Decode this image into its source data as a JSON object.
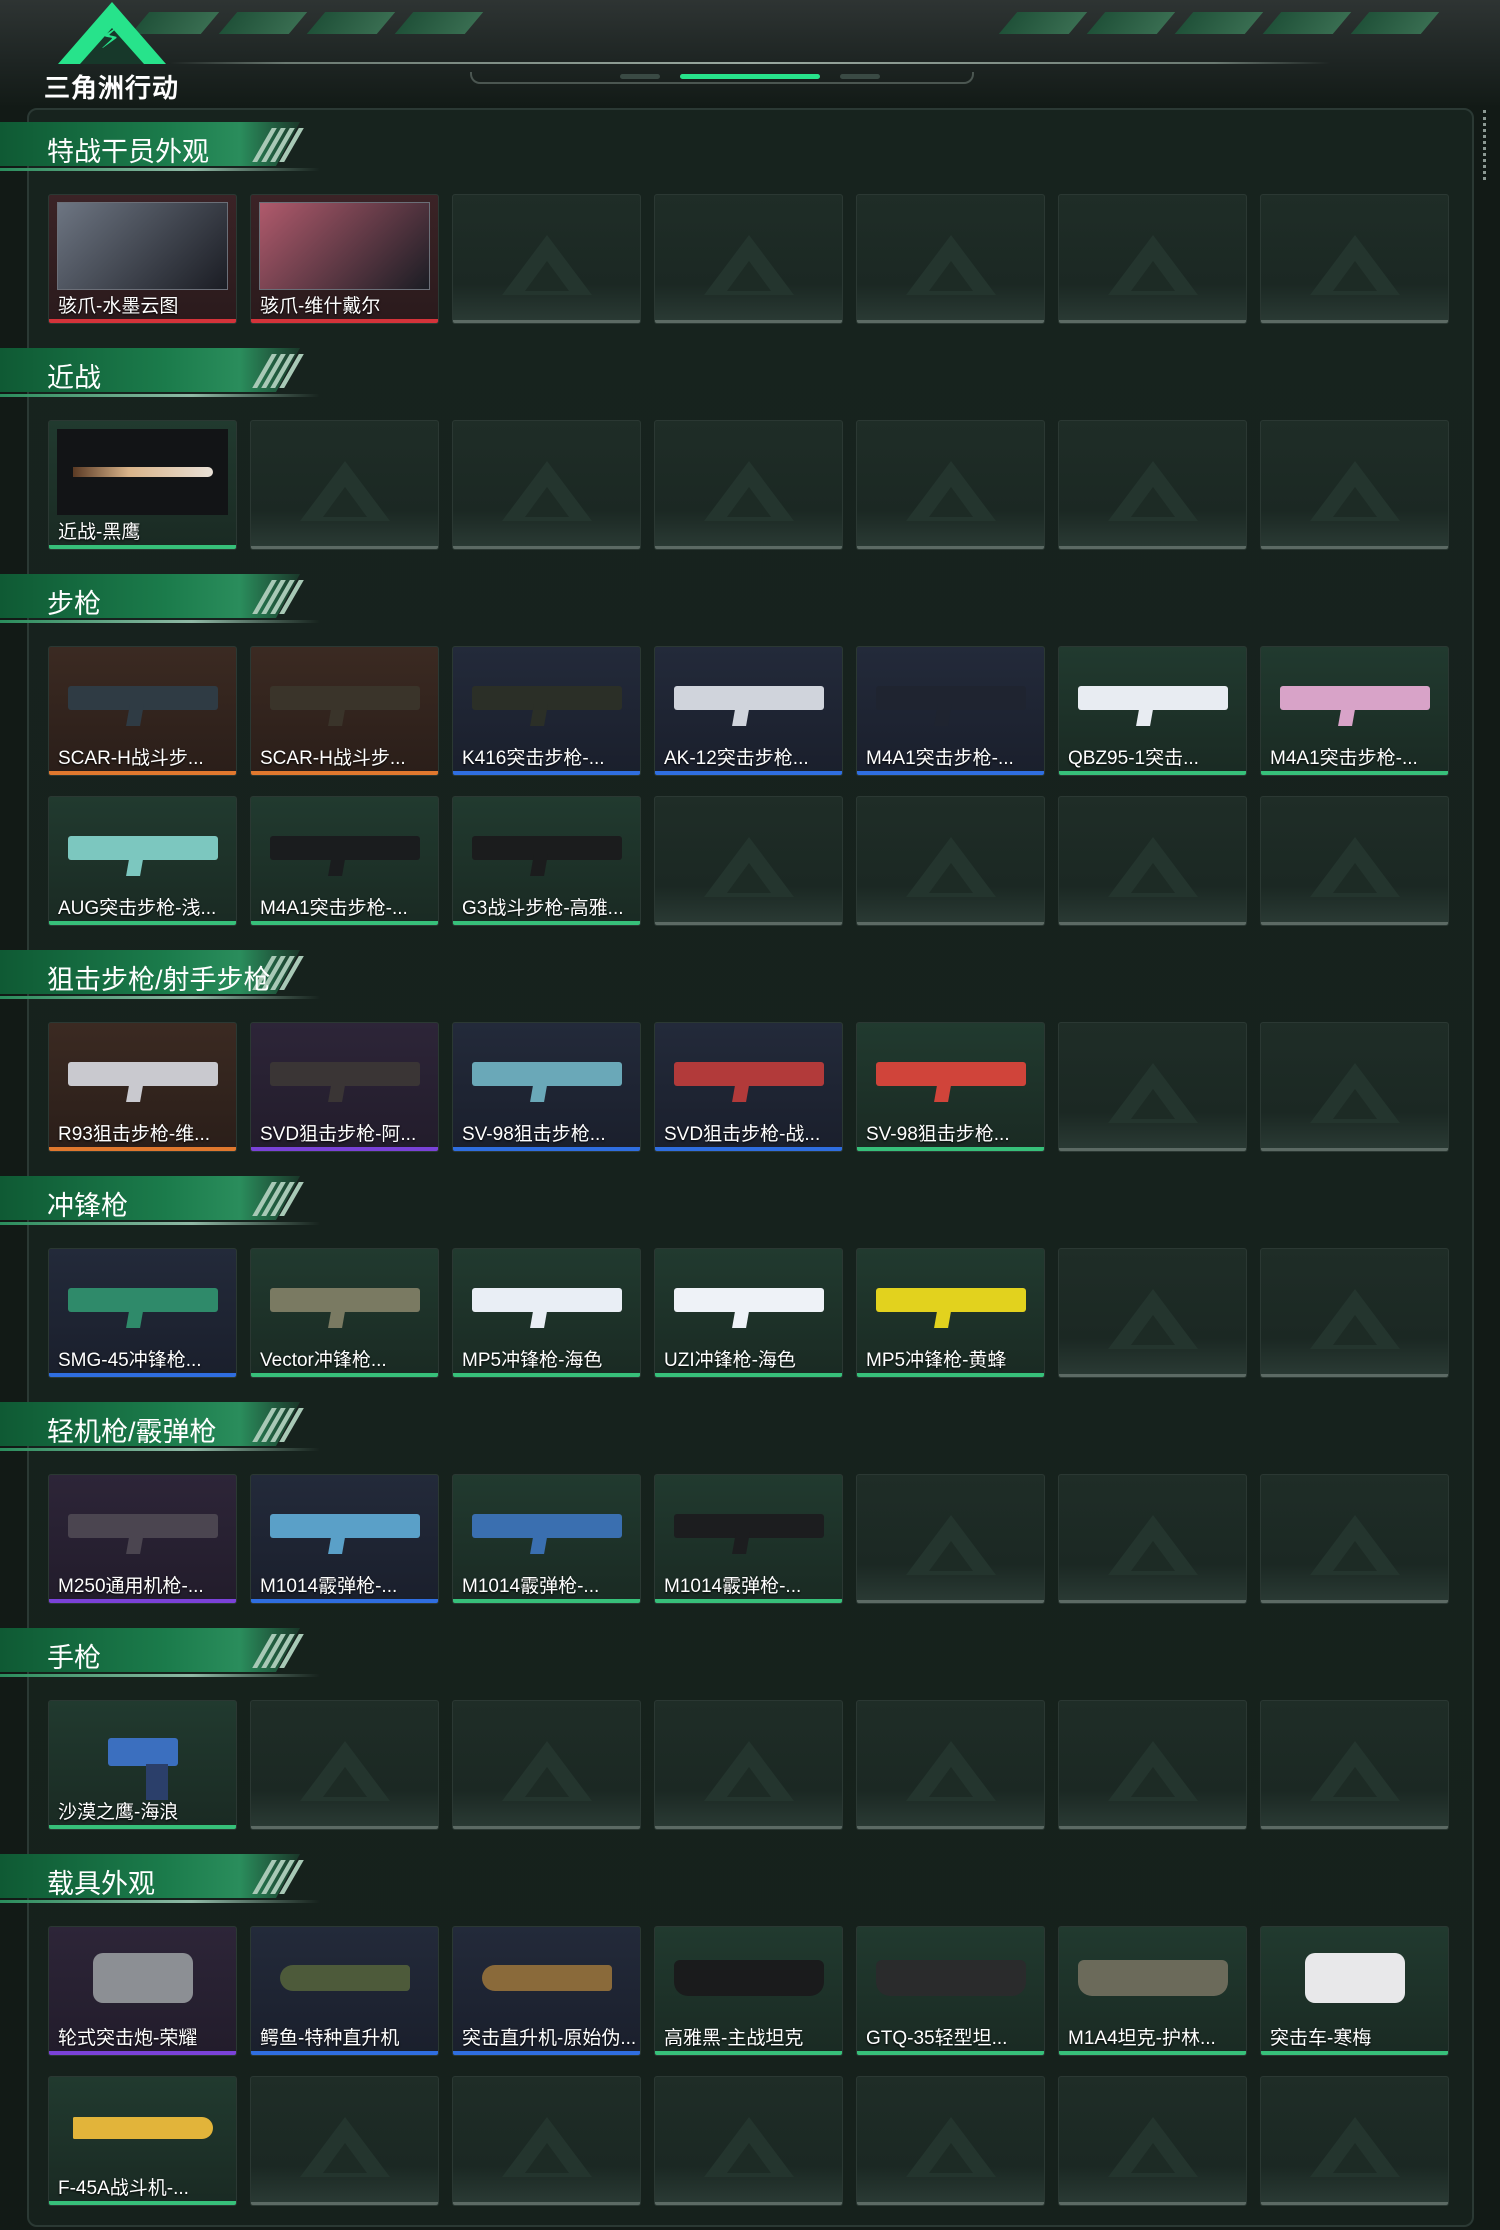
{
  "header": {
    "logo_text": "三角洲行动"
  },
  "sections": [
    {
      "title": "特战干员外观",
      "items": [
        {
          "name": "骇爪-水墨云图",
          "rarity": "red",
          "art": "portrait",
          "color": "#6d7582",
          "label": "水墨云图"
        },
        {
          "name": "骇爪-维什戴尔",
          "rarity": "red",
          "art": "portrait",
          "color": "#b05a6c",
          "label": "维什戴尔"
        }
      ]
    },
    {
      "title": "近战",
      "items": [
        {
          "name": "近战-黑鹰",
          "rarity": "green",
          "art": "knife",
          "color": "#d9b48a"
        }
      ]
    },
    {
      "title": "步枪",
      "items": [
        {
          "name": "SCAR-H战斗步...",
          "rarity": "orange",
          "art": "gun",
          "color": "#2f3b44"
        },
        {
          "name": "SCAR-H战斗步...",
          "rarity": "orange",
          "art": "gun",
          "color": "#3a342a"
        },
        {
          "name": "K416突击步枪-...",
          "rarity": "blue",
          "art": "gun",
          "color": "#2b2f27"
        },
        {
          "name": "AK-12突击步枪...",
          "rarity": "blue",
          "art": "gun",
          "color": "#d0d4dc"
        },
        {
          "name": "M4A1突击步枪-...",
          "rarity": "blue",
          "art": "gun",
          "color": "#1f2430"
        },
        {
          "name": "QBZ95-1突击...",
          "rarity": "green",
          "art": "gun",
          "color": "#e8ecf2"
        },
        {
          "name": "M4A1突击步枪-...",
          "rarity": "green",
          "art": "gun",
          "color": "#d8a3c8"
        },
        {
          "name": "AUG突击步枪-浅...",
          "rarity": "green",
          "art": "gun",
          "color": "#7cc7bf"
        },
        {
          "name": "M4A1突击步枪-...",
          "rarity": "green",
          "art": "gun",
          "color": "#1a1c1e"
        },
        {
          "name": "G3战斗步枪-高雅...",
          "rarity": "green",
          "art": "gun",
          "color": "#1b1c1d"
        }
      ]
    },
    {
      "title": "狙击步枪/射手步枪",
      "items": [
        {
          "name": "R93狙击步枪-维...",
          "rarity": "orange",
          "art": "gun",
          "color": "#c9c9cf"
        },
        {
          "name": "SVD狙击步枪-阿...",
          "rarity": "purple",
          "art": "gun",
          "color": "#3a3535"
        },
        {
          "name": "SV-98狙击步枪...",
          "rarity": "blue",
          "art": "gun",
          "color": "#6aa8b8"
        },
        {
          "name": "SVD狙击步枪-战...",
          "rarity": "blue",
          "art": "gun",
          "color": "#b23a3a"
        },
        {
          "name": "SV-98狙击步枪...",
          "rarity": "green",
          "art": "gun",
          "color": "#d0443a"
        }
      ]
    },
    {
      "title": "冲锋枪",
      "items": [
        {
          "name": "SMG-45冲锋枪...",
          "rarity": "blue",
          "art": "gun",
          "color": "#2f8a6a"
        },
        {
          "name": "Vector冲锋枪...",
          "rarity": "green",
          "art": "gun",
          "color": "#7a7a62"
        },
        {
          "name": "MP5冲锋枪-海色",
          "rarity": "green",
          "art": "gun",
          "color": "#e9eef5"
        },
        {
          "name": "UZI冲锋枪-海色",
          "rarity": "green",
          "art": "gun",
          "color": "#eef2f7"
        },
        {
          "name": "MP5冲锋枪-黄蜂",
          "rarity": "green",
          "art": "gun",
          "color": "#e2d21e"
        }
      ]
    },
    {
      "title": "轻机枪/霰弹枪",
      "items": [
        {
          "name": "M250通用机枪-...",
          "rarity": "purple",
          "art": "gun",
          "color": "#4b4550"
        },
        {
          "name": "M1014霰弹枪-...",
          "rarity": "blue",
          "art": "gun",
          "color": "#5aa0c8"
        },
        {
          "name": "M1014霰弹枪-...",
          "rarity": "green",
          "art": "gun",
          "color": "#3a6fb0"
        },
        {
          "name": "M1014霰弹枪-...",
          "rarity": "green",
          "art": "gun",
          "color": "#1c1d1f"
        }
      ]
    },
    {
      "title": "手枪",
      "items": [
        {
          "name": "沙漠之鹰-海浪",
          "rarity": "green",
          "art": "pistol",
          "color": "#3b6fbf"
        }
      ]
    },
    {
      "title": "载具外观",
      "items": [
        {
          "name": "轮式突击炮-荣耀",
          "rarity": "purple",
          "art": "vehicle",
          "color": "#8c8f94"
        },
        {
          "name": "鳄鱼-特种直升机",
          "rarity": "blue",
          "art": "heli",
          "color": "#4d5a3a"
        },
        {
          "name": "突击直升机-原始伪...",
          "rarity": "blue",
          "art": "heli",
          "color": "#8a6a3a"
        },
        {
          "name": "高雅黑-主战坦克",
          "rarity": "green",
          "art": "tank",
          "color": "#1a1b1c"
        },
        {
          "name": "GTQ-35轻型坦...",
          "rarity": "green",
          "art": "tank",
          "color": "#2a2b2c"
        },
        {
          "name": "M1A4坦克-护林...",
          "rarity": "green",
          "art": "tank",
          "color": "#6b6a5a"
        },
        {
          "name": "突击车-寒梅",
          "rarity": "green",
          "art": "vehicle",
          "color": "#e8e8ea"
        },
        {
          "name": "F-45A战斗机-...",
          "rarity": "green",
          "art": "jet",
          "color": "#e2b43a"
        }
      ]
    }
  ],
  "rarity_colors": {
    "red": "#d3333a",
    "orange": "#e0782e",
    "purple": "#7a42d8",
    "blue": "#2f6ee0",
    "green": "#37c07a"
  }
}
